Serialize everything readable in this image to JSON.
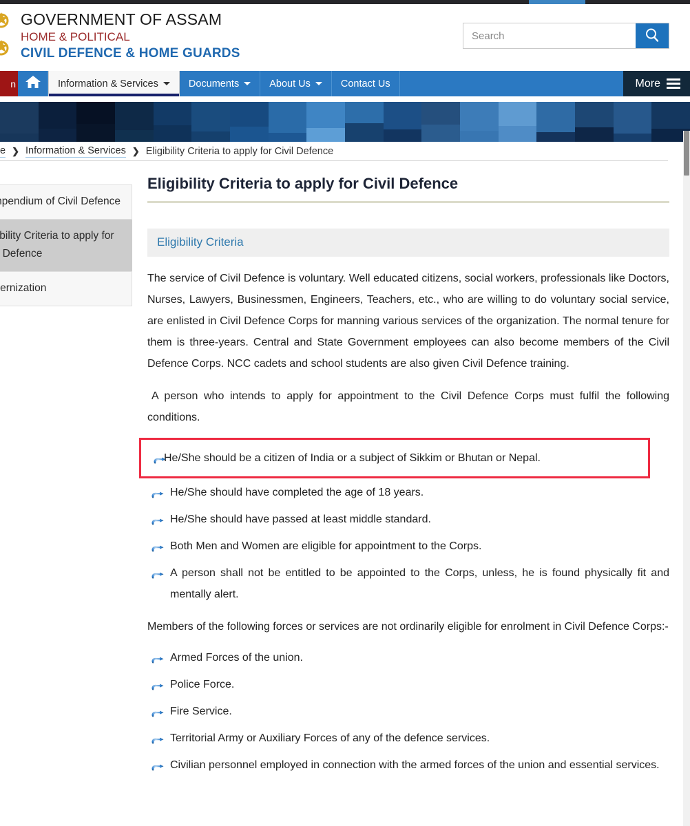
{
  "header": {
    "emblem_icon": "assam-government-emblem-icon",
    "title_line1": "GOVERNMENT OF ASSAM",
    "title_line2": "HOME & POLITICAL",
    "title_line3": "CIVIL DEFENCE & HOME GUARDS",
    "brand_colors": {
      "line1": "#1b1b1b",
      "line2": "#9b2c2c",
      "line3": "#2069b0"
    }
  },
  "search": {
    "placeholder": "Search",
    "value": "",
    "icon": "search-icon",
    "button_color": "#1d72bc"
  },
  "nav": {
    "left_tab_label": "n",
    "home_icon": "home-icon",
    "items": [
      {
        "label": "Information & Services",
        "has_caret": true,
        "active": true
      },
      {
        "label": "Documents",
        "has_caret": true,
        "active": false
      },
      {
        "label": "About Us",
        "has_caret": true,
        "active": false
      },
      {
        "label": "Contact Us",
        "has_caret": false,
        "active": false
      }
    ],
    "more_label": "More",
    "more_icon": "hamburger-menu-icon",
    "bar_color": "#2b79c2",
    "more_color": "#12283a",
    "active_underline_color": "#17216b"
  },
  "banner": {
    "name": "blue-mosaic-banner",
    "columns": [
      {
        "top": "#1b3a5e",
        "bottom": "#17365a"
      },
      {
        "top": "#0b1f3c",
        "bottom": "#0d2342"
      },
      {
        "top": "#061124",
        "bottom": "#081529"
      },
      {
        "top": "#0e2947",
        "bottom": "#10304f"
      },
      {
        "top": "#123a66",
        "bottom": "#0f3259"
      },
      {
        "top": "#1a4c7e",
        "bottom": "#15406d"
      },
      {
        "top": "#174a80",
        "bottom": "#1b5590"
      },
      {
        "top": "#2a6ba8",
        "bottom": "#1d5793"
      },
      {
        "top": "#3f85c4",
        "bottom": "#5d9ed6"
      },
      {
        "top": "#2d6eaa",
        "bottom": "#17416e"
      },
      {
        "top": "#1c4f86",
        "bottom": "#123560"
      },
      {
        "top": "#254f7d",
        "bottom": "#2b5c8e"
      },
      {
        "top": "#3d7cb8",
        "bottom": "#3876b2"
      },
      {
        "top": "#5f9bd1",
        "bottom": "#4f8cc6"
      },
      {
        "top": "#2f6ba5",
        "bottom": "#14335c"
      },
      {
        "top": "#1d4774",
        "bottom": "#0e2647"
      },
      {
        "top": "#27588c",
        "bottom": "#173f6d"
      },
      {
        "top": "#14375f",
        "bottom": "#0c2546"
      }
    ]
  },
  "breadcrumb": {
    "home_label": "e",
    "sep": "❯",
    "parent_label": "Information & Services",
    "current_label": "Eligibility Criteria to apply for Civil Defence"
  },
  "sidebar": {
    "items": [
      {
        "label": "Compendium of Civil Defence",
        "active": false
      },
      {
        "label": "Eligibility Criteria to apply for Civil Defence",
        "active": true
      },
      {
        "label": "Modernization",
        "active": false
      }
    ]
  },
  "main": {
    "page_title": "Eligibility Criteria to apply for Civil Defence",
    "section_heading": "Eligibility Criteria",
    "paragraph_1": "The service of Civil Defence is voluntary. Well educated citizens, social workers, professionals like Doctors, Nurses, Lawyers, Businessmen, Engineers, Teachers, etc., who are willing to do voluntary social service, are enlisted in Civil Defence Corps for manning various services of the organization. The normal tenure for them is three-years. Central and State Government employees can also become members of the Civil Defence Corps. NCC cadets and school students are also given Civil Defence training.",
    "paragraph_2": "A person who intends to apply for appointment to the Civil Defence Corps must fulfil the following conditions.",
    "conditions": [
      {
        "text": "He/She should be a citizen of India or a subject of Sikkim or Bhutan or Nepal.",
        "highlighted": true
      },
      {
        "text": "He/She should have completed the age of 18 years.",
        "highlighted": false
      },
      {
        "text": "He/She should have passed at least middle standard.",
        "highlighted": false
      },
      {
        "text": "Both Men and Women are eligible for appointment to the Corps.",
        "highlighted": false
      },
      {
        "text": "A person shall not be entitled to be appointed to the Corps, unless, he is found physically fit and mentally alert.",
        "highlighted": false
      }
    ],
    "paragraph_3": "Members of the following forces or services are not ordinarily eligible for enrolment in Civil Defence Corps:-",
    "exclusions": [
      {
        "text": "Armed Forces of the union."
      },
      {
        "text": "Police Force."
      },
      {
        "text": "Fire Service."
      },
      {
        "text": "Territorial Army or Auxiliary Forces of any of the defence services."
      },
      {
        "text": "Civilian personnel employed in connection with the armed forces of the union and essential services."
      }
    ],
    "bullet_icon": "pointing-hand-icon",
    "highlight_color": "#ee2b42",
    "section_heading_color": "#2f79ad"
  }
}
